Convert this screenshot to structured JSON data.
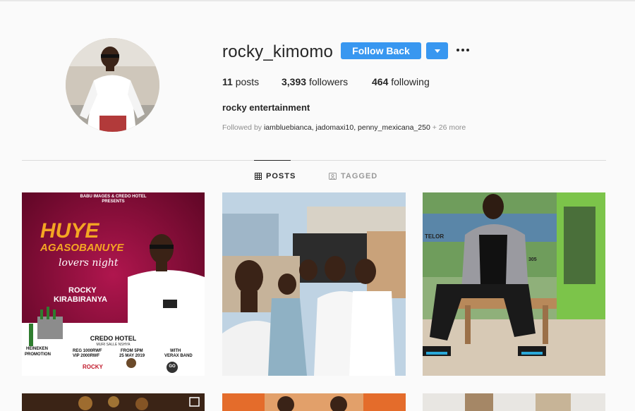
{
  "profile": {
    "username": "rocky_kimomo",
    "follow_label": "Follow Back",
    "full_name": "rocky entertainment",
    "stats": {
      "posts_count": "11",
      "posts_label": "posts",
      "followers_count": "3,393",
      "followers_label": "followers",
      "following_count": "464",
      "following_label": "following"
    },
    "followed_by": {
      "prefix": "Followed by ",
      "names": "iamblu​ebianca, jadomaxi10, penny_mexicana_250",
      "more": " + 26 more"
    }
  },
  "tabs": [
    {
      "label": "POSTS",
      "icon": "grid-icon",
      "active": true
    },
    {
      "label": "TAGGED",
      "icon": "tag-icon",
      "active": false
    }
  ],
  "poster": {
    "header_line1": "BABU IMAGES & CREDO HOTEL",
    "header_line2": "PRESENTS",
    "title1": "HUYE",
    "title2": "AGASOBANUYE",
    "subtitle": "lovers night",
    "artist1": "ROCKY",
    "artist2": "KIRABIRANYA",
    "venue": "CREDO HOTEL",
    "venue_sub": "MURI SALLE NSHYA",
    "sponsor1": "HEINEKEN",
    "sponsor2": "PROMOTION",
    "price1": "REG 1000RWF",
    "price2": "VIP 2000RWF",
    "time1": "FROM 5PM",
    "time2": "25 MAY 2019",
    "band1": "WITH",
    "band2": "VERAX BAND",
    "logo_text": "ROCKY",
    "logo_go": "GO"
  },
  "photo3": {
    "sign_text": "TELOR",
    "sign_num": "305"
  },
  "colors": {
    "accent": "#3897f0",
    "text": "#262626",
    "muted": "#8e8e8e",
    "background": "#fafafa"
  }
}
